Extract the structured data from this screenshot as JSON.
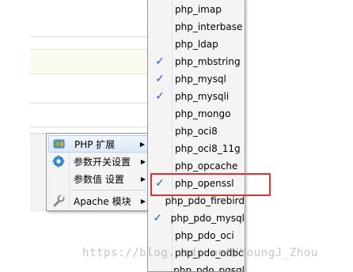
{
  "context_menu": {
    "items": [
      {
        "label": "PHP 扩展",
        "icon": "php-extension-icon",
        "has_submenu": true,
        "highlighted": true
      },
      {
        "label": "参数开关设置",
        "icon": "gear-icon",
        "has_submenu": true,
        "highlighted": false
      },
      {
        "label": "参数值 设置",
        "icon": "",
        "has_submenu": true,
        "highlighted": false
      },
      {
        "label": "Apache 模块",
        "icon": "wrench-icon",
        "has_submenu": true,
        "highlighted": false
      }
    ]
  },
  "submenu": {
    "items": [
      {
        "label": "php_imap",
        "checked": false
      },
      {
        "label": "php_interbase",
        "checked": false
      },
      {
        "label": "php_ldap",
        "checked": false
      },
      {
        "label": "php_mbstring",
        "checked": true
      },
      {
        "label": "php_mysql",
        "checked": true
      },
      {
        "label": "php_mysqli",
        "checked": true
      },
      {
        "label": "php_mongo",
        "checked": false
      },
      {
        "label": "php_oci8",
        "checked": false
      },
      {
        "label": "php_oci8_11g",
        "checked": false
      },
      {
        "label": "php_opcache",
        "checked": false
      },
      {
        "label": "php_openssl",
        "checked": true
      },
      {
        "label": "php_pdo_firebird",
        "checked": false
      },
      {
        "label": "php_pdo_mysql",
        "checked": true
      },
      {
        "label": "php_pdo_oci",
        "checked": false
      },
      {
        "label": "php_pdo_odbc",
        "checked": false
      },
      {
        "label": "php_pdo_pgsql",
        "checked": false
      }
    ],
    "check_glyph": "✓"
  },
  "arrow_glyph": "▶",
  "watermark": "https://blog.csdn.net/YoungJ_Zhou",
  "colors": {
    "check": "#1f5fbf",
    "highlight_box": "#e03030",
    "menu_bg": "#f4f4f4"
  }
}
